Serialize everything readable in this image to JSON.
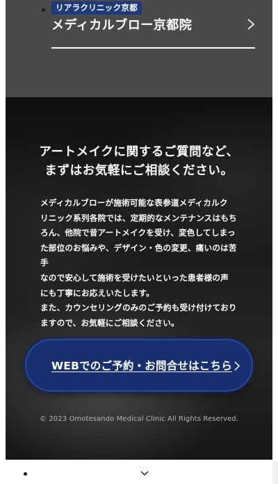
{
  "clinic": {
    "badge": "リアラクリニック京都",
    "name": "メディカルブロー京都院",
    "chevron_icon": "chevron-right-icon"
  },
  "contact": {
    "heading_line1": "アートメイクに関するご質問など、",
    "heading_line2": "まずはお気軽にご相談ください。",
    "body_lines": [
      "メディカルブローが施術可能な表参道メディカルク",
      "リニック系列各院では、定期的なメンテナンスはもち",
      "ろん、他院で昔アートメイクを受け、変色してしまっ",
      "た部位のお悩みや、デザイン・色の変更、痛いのは苦手",
      "なので安心して施術を受けたいといった患者様の声",
      "にも丁寧にお応えいたします。",
      "また、カウンセリングのみのご予約も受け付けており",
      "ますので、お気軽にご相談ください。"
    ],
    "cta_label": "WEBでのご予約・お問合せはこちら",
    "cta_icon": "chevron-right-icon",
    "copyright": "© 2023 Omotesando Medical Clinic All Rights Reserved."
  },
  "footer": {
    "toggle_icon": "chevron-down-icon"
  },
  "colors": {
    "badge_bg": "#1f3a7a",
    "cta_bg": "#18306f",
    "top_section_bg": "#4a4a4a"
  }
}
